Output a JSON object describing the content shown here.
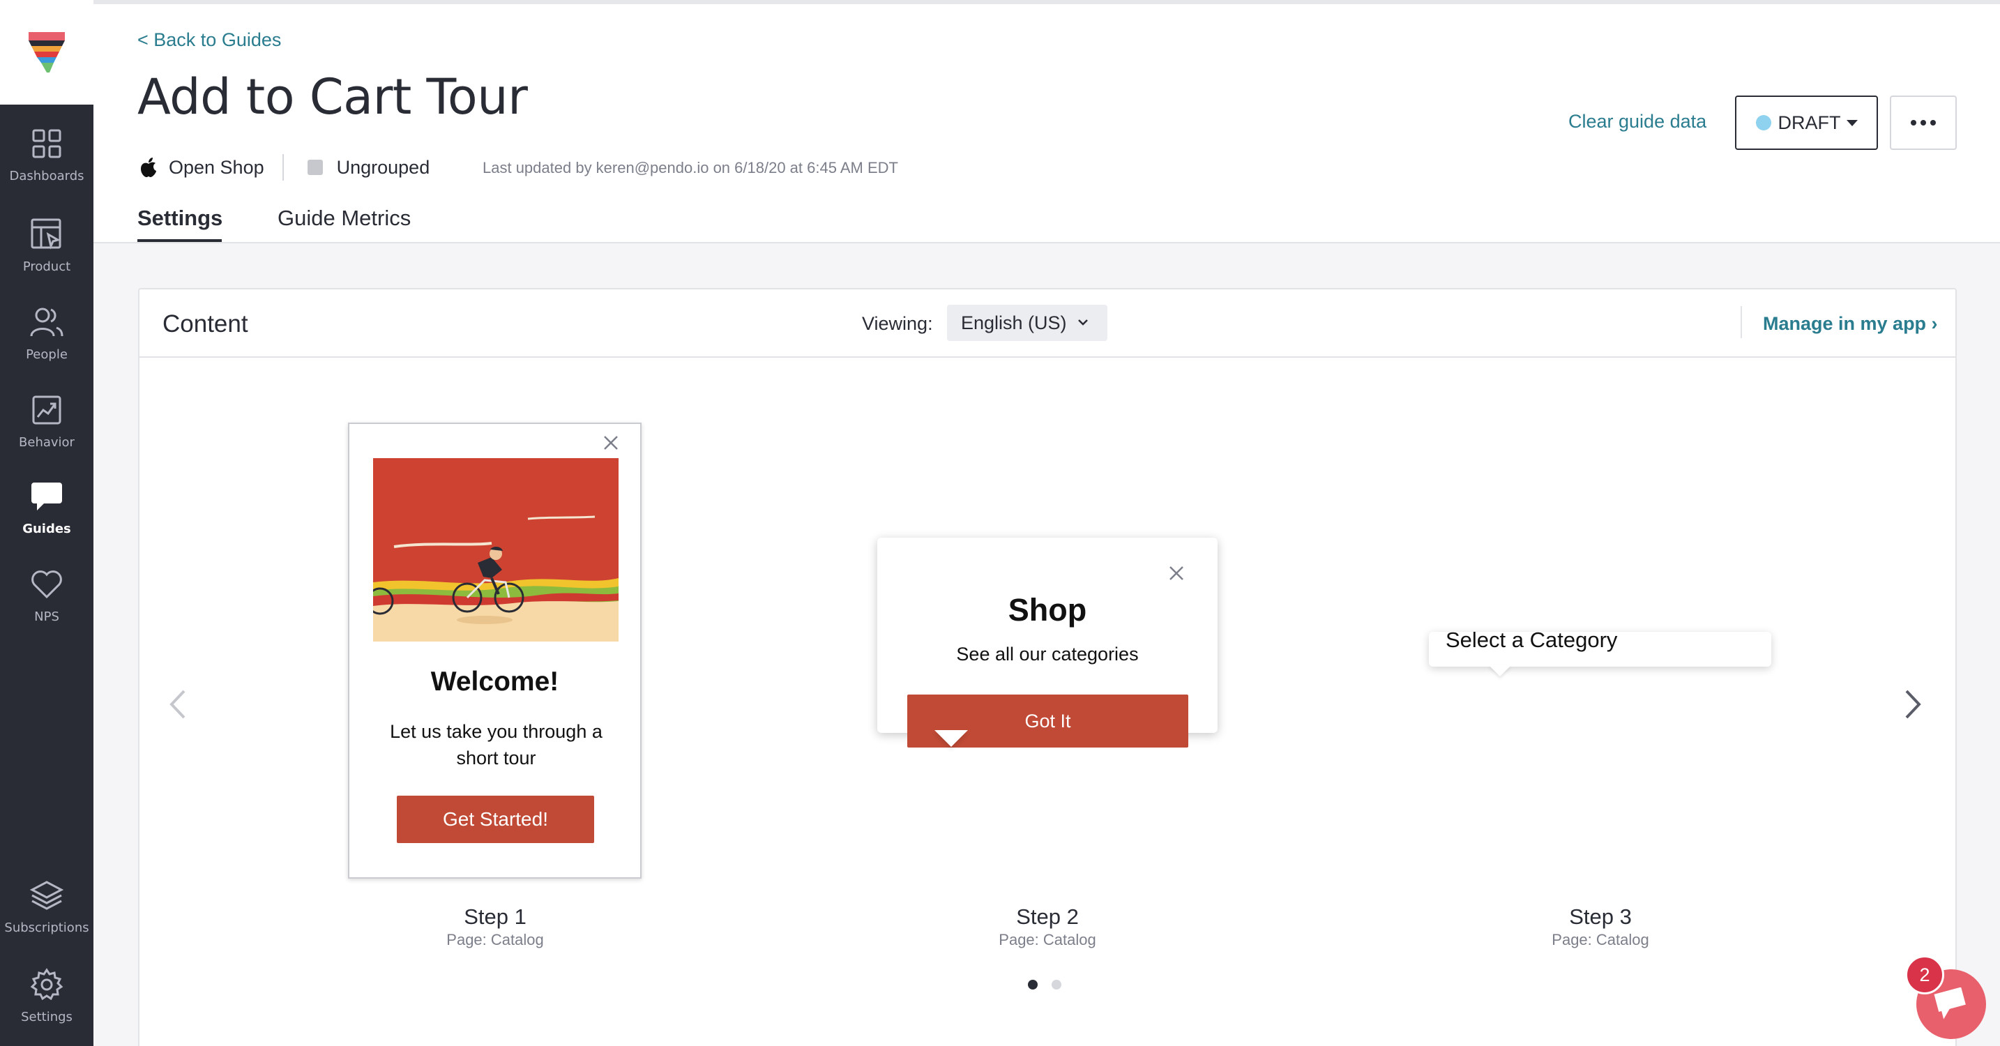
{
  "sidebar": {
    "items": [
      {
        "label": "Dashboards",
        "icon": "grid-icon"
      },
      {
        "label": "Product",
        "icon": "layout-pointer-icon"
      },
      {
        "label": "People",
        "icon": "people-icon"
      },
      {
        "label": "Behavior",
        "icon": "chart-icon"
      },
      {
        "label": "Guides",
        "icon": "chat-bubble-icon",
        "active": true
      },
      {
        "label": "NPS",
        "icon": "heart-icon"
      },
      {
        "label": "Subscriptions",
        "icon": "layers-icon"
      },
      {
        "label": "Settings",
        "icon": "gear-icon"
      }
    ]
  },
  "header": {
    "back_link": "< Back to Guides",
    "title": "Add to Cart Tour",
    "app_name": "Open Shop",
    "group": "Ungrouped",
    "last_updated": "Last updated by keren@pendo.io on 6/18/20 at 6:45 AM EDT",
    "clear_data": "Clear guide data",
    "status": "DRAFT"
  },
  "tabs": [
    {
      "label": "Settings",
      "active": true
    },
    {
      "label": "Guide Metrics",
      "active": false
    }
  ],
  "content": {
    "title": "Content",
    "viewing_label": "Viewing:",
    "language": "English (US)",
    "manage_link": "Manage in my app ›",
    "steps": [
      {
        "heading": "Welcome!",
        "body": "Let us take you through a short tour",
        "button": "Get Started!",
        "caption": "Step 1",
        "page": "Page: Catalog"
      },
      {
        "heading": "Shop",
        "body": "See all our categories",
        "button": "Got It",
        "caption": "Step 2",
        "page": "Page: Catalog"
      },
      {
        "body": "Select a Category",
        "caption": "Step 3",
        "page": "Page: Catalog"
      }
    ],
    "pagination": {
      "pages": 2,
      "current": 1
    }
  },
  "chat": {
    "badge_count": "2"
  },
  "colors": {
    "sidebar_bg": "#2a2c35",
    "link": "#2a7c8f",
    "guide_button": "#c04a36",
    "draft_dot": "#8fd2ef",
    "chat": "#e8606b"
  }
}
